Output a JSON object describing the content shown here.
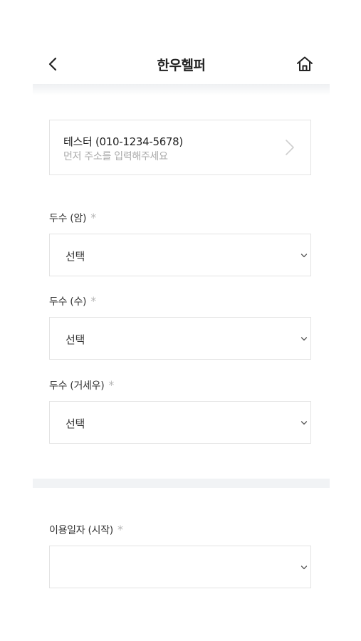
{
  "header": {
    "title": "한우헬퍼",
    "back_icon": "chevron-left-icon",
    "home_icon": "home-icon"
  },
  "address": {
    "name": "테스터 (010-1234-5678)",
    "hint": "먼저 주소를 입력해주세요",
    "chevron_icon": "chevron-right-icon"
  },
  "fields": [
    {
      "label": "두수 (암)",
      "required_mark": "*",
      "value": "선택"
    },
    {
      "label": "두수 (수)",
      "required_mark": "*",
      "value": "선택"
    },
    {
      "label": "두수 (거세우)",
      "required_mark": "*",
      "value": "선택"
    },
    {
      "label": "이용일자 (시작)",
      "required_mark": "*",
      "value": ""
    }
  ],
  "colors": {
    "border": "#e3e3e3",
    "hint_text": "#aaaaaa",
    "required_mark": "#b5b5b5",
    "divider": "#f1f3f5"
  }
}
